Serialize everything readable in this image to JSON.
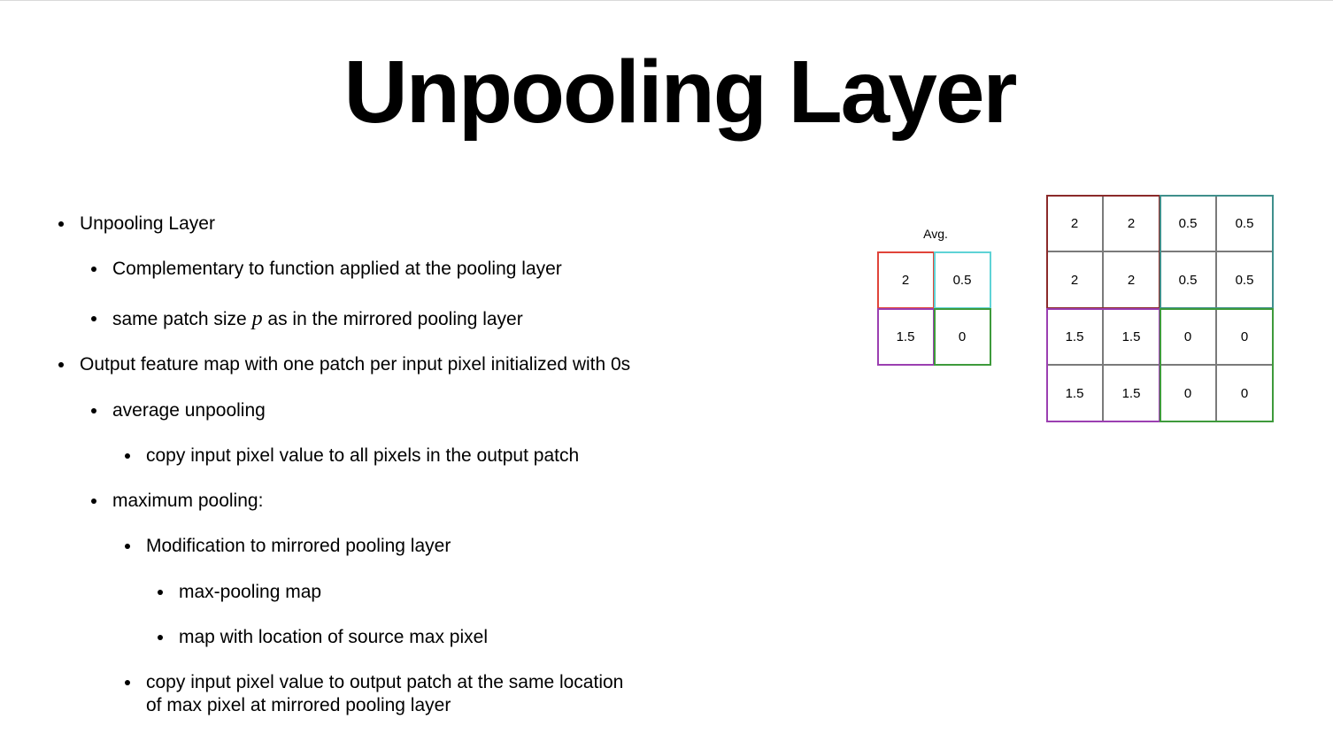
{
  "slide": {
    "title": "Unpooling Layer"
  },
  "bullets": [
    {
      "level": 1,
      "text": "Unpooling Layer"
    },
    {
      "level": 2,
      "text": "Complementary to function applied at the pooling layer"
    },
    {
      "level": 2,
      "text_before": "same patch size ",
      "var": "p",
      "text_after": " as in the mirrored pooling layer"
    },
    {
      "level": 1,
      "text": "Output feature map with one patch per input pixel initialized with 0s"
    },
    {
      "level": 2,
      "text": "average unpooling"
    },
    {
      "level": 3,
      "text": "copy input pixel value to all pixels in the output patch"
    },
    {
      "level": 2,
      "text": "maximum pooling:"
    },
    {
      "level": 3,
      "text": "Modification to mirrored pooling layer"
    },
    {
      "level": 4,
      "text": "max-pooling map"
    },
    {
      "level": 4,
      "text": "map with location of source max pixel"
    },
    {
      "level": 3,
      "text_line1": "copy input pixel value to output patch at the same location",
      "text_line2": "of max pixel at mirrored pooling layer"
    }
  ],
  "input_grid": {
    "label": "Avg.",
    "cells": [
      [
        "2",
        "0.5"
      ],
      [
        "1.5",
        "0"
      ]
    ]
  },
  "output_grid": {
    "cells": [
      [
        "2",
        "2",
        "0.5",
        "0.5"
      ],
      [
        "2",
        "2",
        "0.5",
        "0.5"
      ],
      [
        "1.5",
        "1.5",
        "0",
        "0"
      ],
      [
        "1.5",
        "1.5",
        "0",
        "0"
      ]
    ]
  },
  "colors": {
    "input_top_left": "#e0443a",
    "input_top_right": "#5fd3d6",
    "input_bottom_left": "#9b3fb1",
    "input_bottom_right": "#3e9a3b",
    "output_top_left": "#8b2a2a",
    "output_top_right": "#3f8f8c",
    "output_bottom_left": "#9b3fb1",
    "output_bottom_right": "#3e9a3b",
    "cell_border": "#7a7a7a"
  }
}
